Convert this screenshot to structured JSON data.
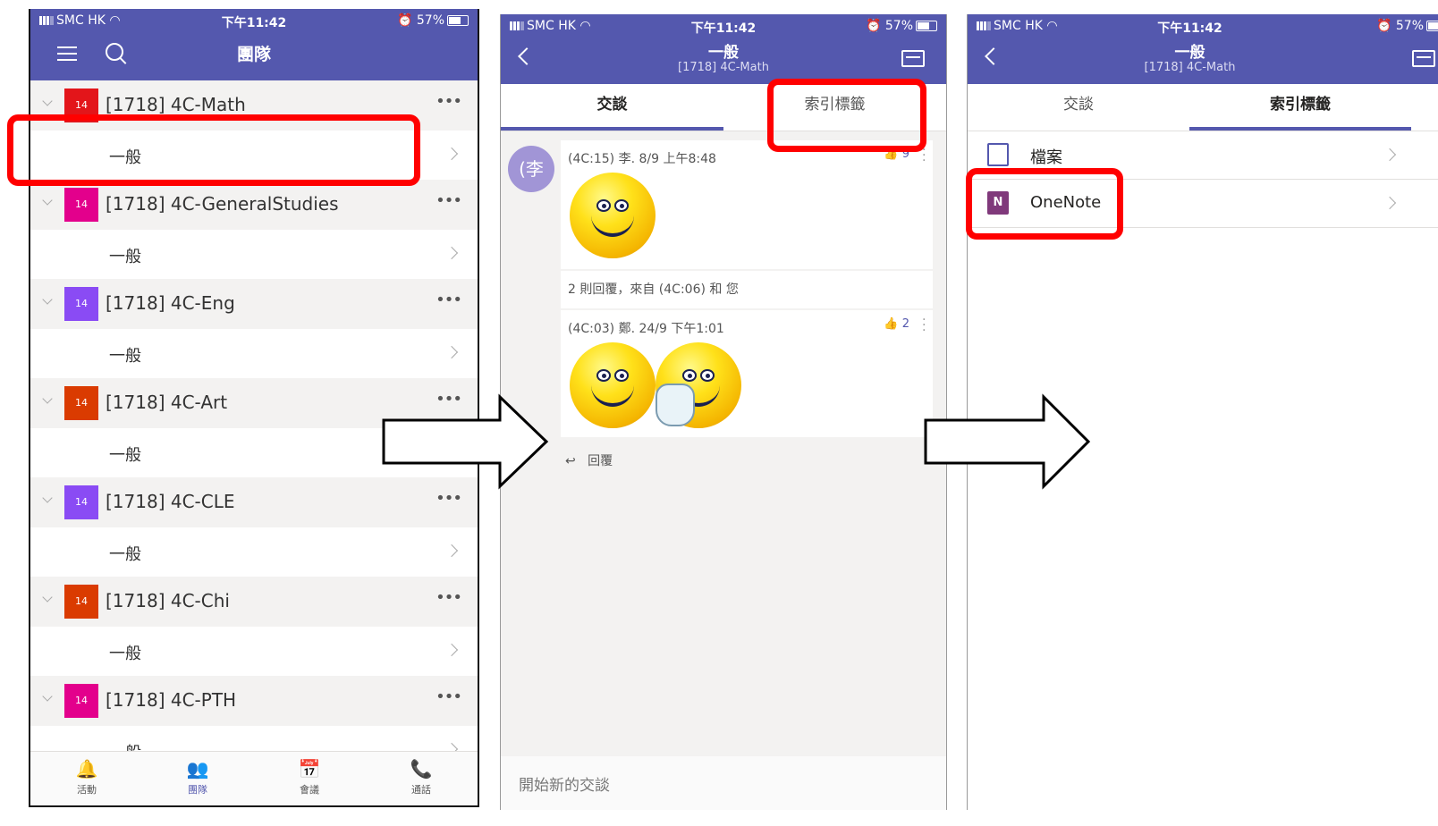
{
  "status_bar": {
    "carrier": "SMC HK",
    "time": "下午11:42",
    "battery": "57%"
  },
  "panel1": {
    "header_title": "團隊",
    "teams": [
      {
        "tile": "14",
        "tile_color": "#e3151a",
        "name": "[1718] 4C-Math",
        "channel": "一般"
      },
      {
        "tile": "14",
        "tile_color": "#e3008c",
        "name": "[1718] 4C-GeneralStudies",
        "channel": "一般"
      },
      {
        "tile": "14",
        "tile_color": "#8a4bf4",
        "name": "[1718] 4C-Eng",
        "channel": "一般"
      },
      {
        "tile": "14",
        "tile_color": "#da3b01",
        "name": "[1718] 4C-Art",
        "channel": "一般"
      },
      {
        "tile": "14",
        "tile_color": "#8a4bf4",
        "name": "[1718] 4C-CLE",
        "channel": "一般"
      },
      {
        "tile": "14",
        "tile_color": "#da3b01",
        "name": "[1718] 4C-Chi",
        "channel": "一般"
      },
      {
        "tile": "14",
        "tile_color": "#e3008c",
        "name": "[1718] 4C-PTH",
        "channel": "一般"
      }
    ],
    "more_icon": "•••",
    "bottom_tabs": [
      {
        "label": "活動",
        "icon": "bell-icon",
        "glyph": "🔔"
      },
      {
        "label": "團隊",
        "icon": "teams-icon",
        "glyph": "👥"
      },
      {
        "label": "會議",
        "icon": "calendar-icon",
        "glyph": "📅"
      },
      {
        "label": "通話",
        "icon": "phone-icon",
        "glyph": "📞"
      }
    ]
  },
  "panel2": {
    "header_title": "一般",
    "header_subtitle": "[1718] 4C-Math",
    "tabs": [
      "交談",
      "索引標籤"
    ],
    "avatar_text": "(李",
    "post1": {
      "meta": "(4C:15) 李.  8/9 上午8:48",
      "likes": "9"
    },
    "replies_text": "2 則回覆，來自 (4C:06) 和 您",
    "post2": {
      "meta": "(4C:03) 鄭.  24/9 下午1:01",
      "likes": "2"
    },
    "reply_label": "回覆",
    "compose_placeholder": "開始新的交談"
  },
  "panel3": {
    "header_title": "一般",
    "header_subtitle": "[1718] 4C-Math",
    "tabs": [
      "交談",
      "索引標籤"
    ],
    "items": [
      {
        "label": "檔案",
        "icon": "files-icon"
      },
      {
        "label": "OneNote",
        "icon": "onenote-icon",
        "icon_text": "N"
      }
    ]
  },
  "colors": {
    "header": "#5458ae",
    "highlight": "#ff0000"
  }
}
